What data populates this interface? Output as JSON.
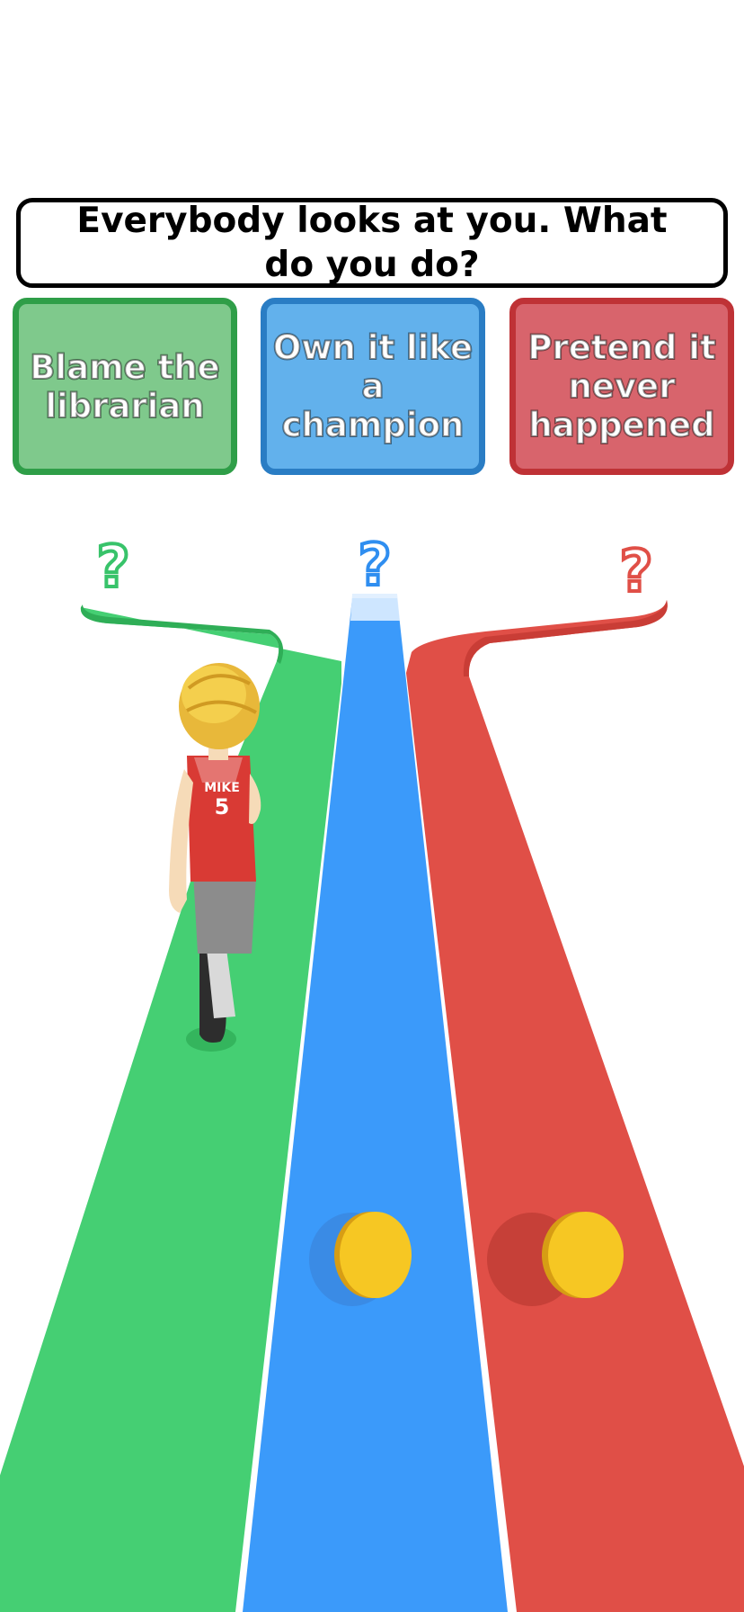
{
  "question": "Everybody looks at you. What do you do?",
  "answers": [
    {
      "text": "Blame the librarian",
      "color": "#7fc98c"
    },
    {
      "text": "Own it like a champion",
      "color": "#62b1ec"
    },
    {
      "text": "Pretend it never happened",
      "color": "#d8646c"
    }
  ],
  "lanes": {
    "green": "#45cf73",
    "blue": "#3b9afa",
    "red": "#e04f47"
  },
  "markers": {
    "green": "?",
    "blue": "?",
    "red": "?"
  },
  "player": {
    "jersey_name": "MIKE",
    "jersey_number": "5"
  },
  "coins": {
    "color": "#f6c723",
    "visible_count": 2
  }
}
